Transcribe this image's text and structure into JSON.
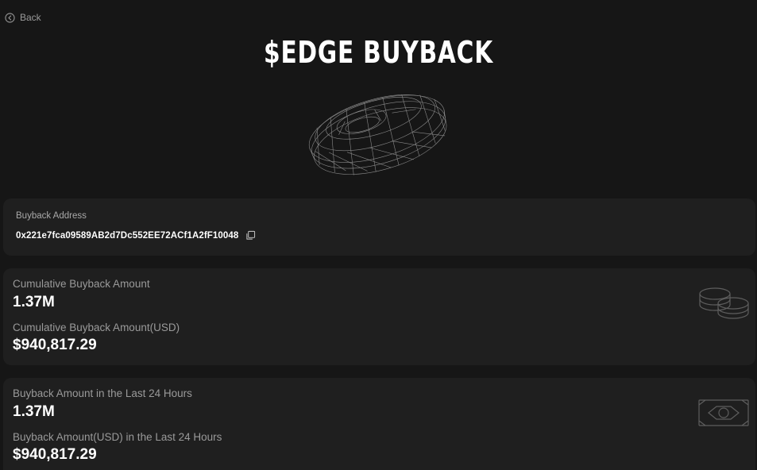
{
  "nav": {
    "back_label": "Back"
  },
  "header": {
    "title": "$EDGE BUYBACK"
  },
  "address_card": {
    "label": "Buyback Address",
    "address": "0x221e7fca09589AB2d7Dc552EE72ACf1A2fF10048",
    "copy_icon": "copy-icon"
  },
  "cumulative_card": {
    "amount_label": "Cumulative Buyback Amount",
    "amount_value": "1.37M",
    "usd_label": "Cumulative Buyback Amount(USD)",
    "usd_value": "$940,817.29",
    "icon": "coins-icon"
  },
  "last24h_card": {
    "amount_label": "Buyback Amount in the Last 24 Hours",
    "amount_value": "1.37M",
    "usd_label": "Buyback Amount(USD) in the Last 24 Hours",
    "usd_value": "$940,817.29",
    "icon": "banknote-icon"
  },
  "colors": {
    "background": "#161616",
    "card": "#1f1f1f",
    "label": "#9a9a9a",
    "value": "#ffffff"
  }
}
